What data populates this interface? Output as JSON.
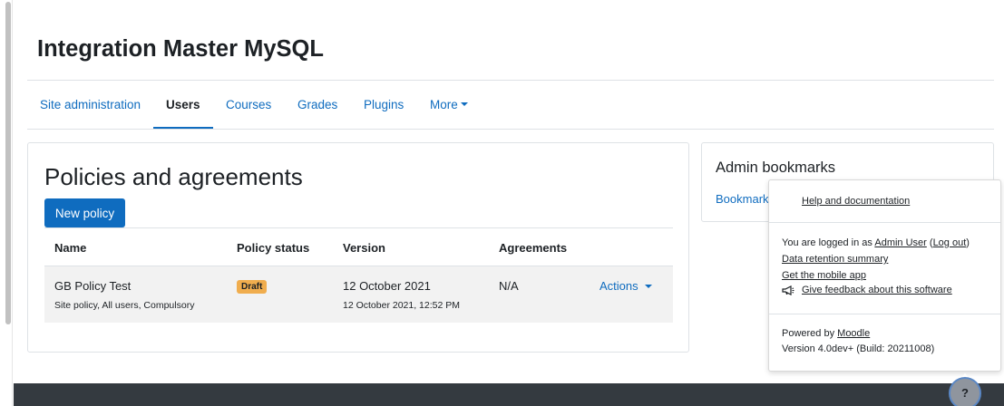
{
  "site": {
    "title": "Integration Master MySQL"
  },
  "nav": {
    "items": [
      {
        "label": "Site administration"
      },
      {
        "label": "Users"
      },
      {
        "label": "Courses"
      },
      {
        "label": "Grades"
      },
      {
        "label": "Plugins"
      },
      {
        "label": "More"
      }
    ],
    "active": "Users"
  },
  "main": {
    "heading": "Policies and agreements",
    "new_policy_label": "New policy",
    "table": {
      "headers": [
        "Name",
        "Policy status",
        "Version",
        "Agreements"
      ],
      "rows": [
        {
          "name": "GB Policy Test",
          "details": "Site policy, All users, Compulsory",
          "status": "Draft",
          "version": "12 October 2021",
          "version_time": "12 October 2021, 12:52 PM",
          "agreements": "N/A",
          "actions_label": "Actions"
        }
      ]
    }
  },
  "sidebar": {
    "block_title": "Admin bookmarks",
    "link_label": "Bookmarks"
  },
  "popover": {
    "help_label": "Help and documentation",
    "logged_in_prefix": "You are logged in as ",
    "user_name": "Admin User",
    "logout_label": "Log out",
    "data_retention_label": "Data retention summary",
    "mobile_app_label": "Get the mobile app",
    "feedback_label": "Give feedback about this software",
    "powered_prefix": "Powered by ",
    "powered_link": "Moodle",
    "version_text": "Version 4.0dev+ (Build: 20211008)"
  },
  "help_button": {
    "label": "?"
  },
  "colors": {
    "link": "#0f6cbf",
    "primary": "#0f6cbf",
    "badge_draft": "#f0ad4e",
    "footer": "#343a40"
  },
  "icons": [
    "megaphone-icon",
    "caret-down-icon",
    "chevron-up-icon",
    "question-icon"
  ]
}
